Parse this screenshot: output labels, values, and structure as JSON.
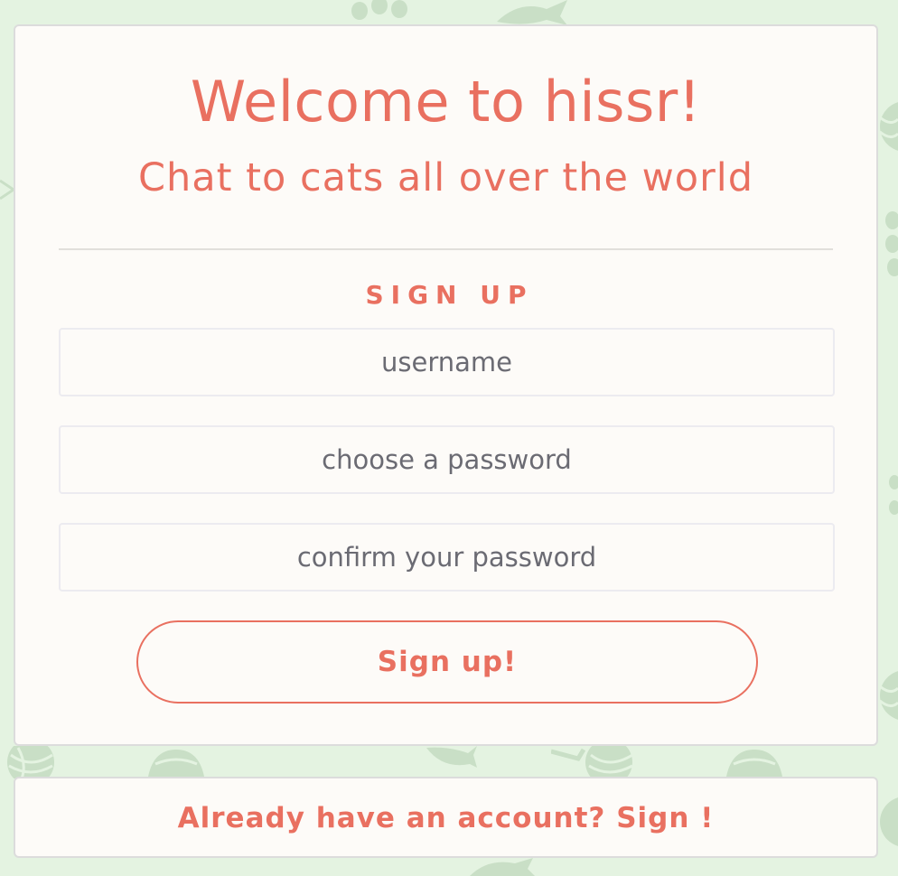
{
  "header": {
    "title": "Welcome to hissr!",
    "subtitle": "Chat to cats all over the world"
  },
  "signup": {
    "heading": "SIGN UP",
    "username_placeholder": "username",
    "password_placeholder": "choose a password",
    "confirm_placeholder": "confirm your password",
    "submit_label": "Sign up!"
  },
  "footer": {
    "signin_link": "Already have an account? Sign !"
  },
  "colors": {
    "accent": "#e97060",
    "background": "#e4f3e1",
    "card": "#fdfbf8",
    "pattern": "#c9dfc6"
  },
  "background_icons": [
    "paw-icon",
    "fish-icon",
    "yarn-ball-icon",
    "food-bowl-icon"
  ]
}
